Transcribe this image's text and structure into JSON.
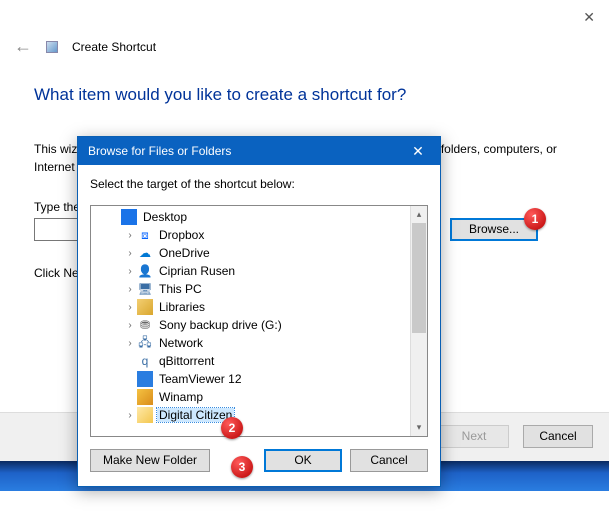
{
  "wizard": {
    "title": "Create Shortcut",
    "question": "What item would you like to create a shortcut for?",
    "description": "This wizard helps you to create shortcuts to local or network programs, files, folders, computers, or Internet addresses.",
    "input_label": "Type the location of the item:",
    "input_value": "",
    "browse_label": "Browse...",
    "click_next": "Click Next to continue.",
    "next_label": "Next",
    "cancel_label": "Cancel"
  },
  "dialog": {
    "title": "Browse for Files or Folders",
    "subtitle": "Select the target of the shortcut below:",
    "make_folder_label": "Make New Folder",
    "ok_label": "OK",
    "cancel_label": "Cancel",
    "tree": {
      "root": "Desktop",
      "items": [
        {
          "expander": "›",
          "icon": "dropbox",
          "label": "Dropbox"
        },
        {
          "expander": "›",
          "icon": "onedrive",
          "label": "OneDrive"
        },
        {
          "expander": "›",
          "icon": "user",
          "label": "Ciprian Rusen"
        },
        {
          "expander": "›",
          "icon": "pc",
          "label": "This PC"
        },
        {
          "expander": "›",
          "icon": "lib",
          "label": "Libraries"
        },
        {
          "expander": "›",
          "icon": "drive",
          "label": "Sony backup drive (G:)"
        },
        {
          "expander": "›",
          "icon": "net",
          "label": "Network"
        },
        {
          "expander": "",
          "icon": "qt",
          "label": "qBittorrent"
        },
        {
          "expander": "",
          "icon": "tv",
          "label": "TeamViewer 12"
        },
        {
          "expander": "",
          "icon": "wa",
          "label": "Winamp"
        },
        {
          "expander": "›",
          "icon": "folder",
          "label": "Digital Citizen",
          "selected": true
        }
      ]
    }
  },
  "annotations": {
    "b1": "1",
    "b2": "2",
    "b3": "3"
  }
}
